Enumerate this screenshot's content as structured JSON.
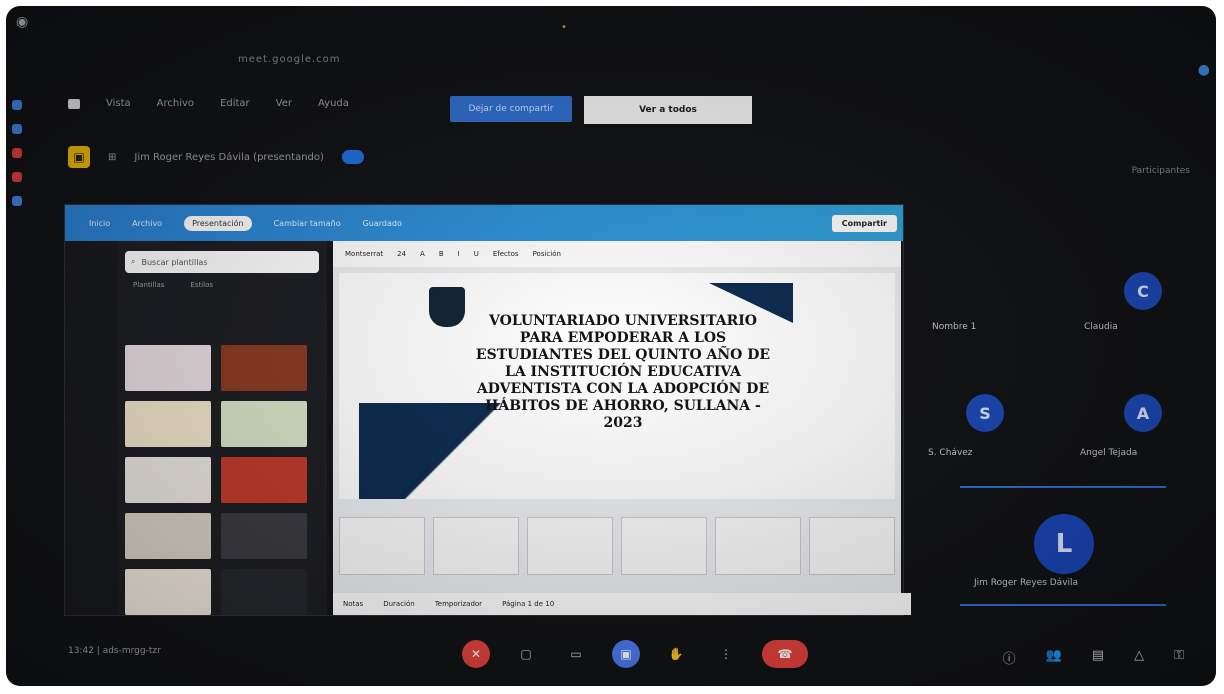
{
  "window": {
    "title": "meet.google.com",
    "top_indicator": "•"
  },
  "menu": {
    "items": [
      "Vista",
      "Archivo",
      "Editar",
      "Ver",
      "Ayuda"
    ],
    "share_button": "Dejar de compartir",
    "view_button": "Ver a todos"
  },
  "presenter": {
    "label": "Jim Roger Reyes Dávila (presentando)",
    "right_label": "Participantes"
  },
  "canva": {
    "tabs": [
      "Inicio",
      "Archivo",
      "Cambiar tamaño",
      "Guardado"
    ],
    "title_pill": "Presentación",
    "share_label": "Compartir",
    "search_placeholder": "Buscar plantillas",
    "panel_tabs": [
      "Plantillas",
      "Estilos"
    ],
    "toolbar_items": [
      "Montserrat",
      "24",
      "A",
      "B",
      "I",
      "U",
      "Efectos",
      "Posición"
    ],
    "slide_title": "VOLUNTARIADO UNIVERSITARIO PARA EMPODERAR A LOS ESTUDIANTES DEL QUINTO AÑO DE LA INSTITUCIÓN EDUCATIVA ADVENTISTA CON LA ADOPCIÓN DE HÁBITOS DE AHORRO, SULLANA - 2023",
    "footer_items": [
      "Notas",
      "Duración",
      "Temporizador",
      "Página 1 de 10"
    ]
  },
  "participants": [
    {
      "name": "Nombre 1",
      "initial": ""
    },
    {
      "name": "Claudia",
      "initial": "C"
    },
    {
      "name": "S. Chávez",
      "initial": "S"
    },
    {
      "name": "Angel Tejada",
      "initial": "A"
    }
  ],
  "speaker": {
    "name": "Jim Roger Reyes Dávila",
    "initial": "L"
  },
  "bottom": {
    "room": "13:42 | ads-mrgg-tzr"
  },
  "colors": {
    "accent": "#2f6fcf",
    "danger": "#e3413b",
    "bg": "#101114"
  }
}
